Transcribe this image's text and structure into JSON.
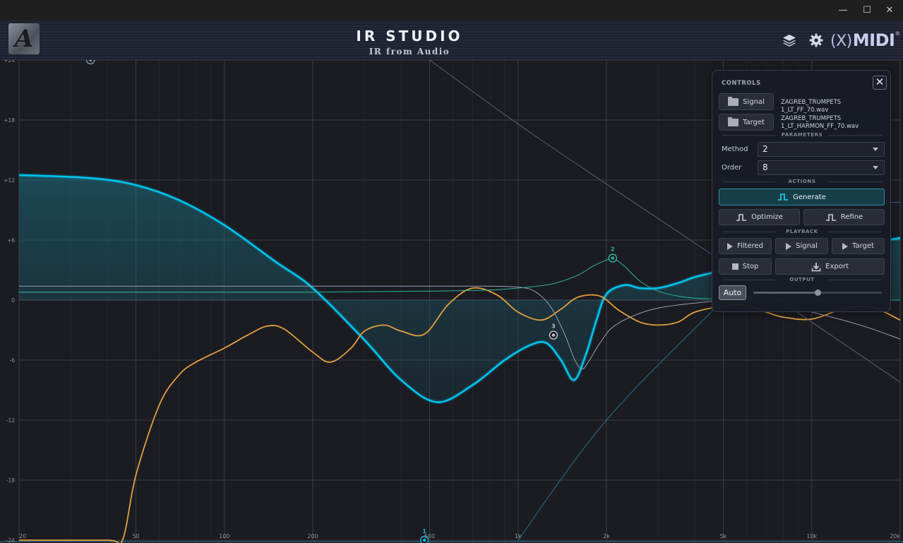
{
  "window": {
    "minimize": "—",
    "maximize": "☐",
    "close": "✕"
  },
  "header": {
    "logo_text": "A",
    "title": "IR STUDIO",
    "subtitle": "IR from Audio",
    "icons": [
      "layers-icon",
      "gear-icon"
    ],
    "brand_symbol": "(X)",
    "brand_text": "MIDI",
    "brand_mark": "®"
  },
  "controls": {
    "title": "CONTROLS",
    "close_label": "✕",
    "signal_button": "Signal",
    "signal_file": "ZAGREB_TRUMPETS 1_LT_FF_70.wav",
    "target_button": "Target",
    "target_file_line1": "ZAGREB_TRUMPETS",
    "target_file_line2": "1_LT_HARMON_FF_70.wav",
    "parameters_label": "PARAMETERS",
    "method_label": "Method",
    "method_value": "2",
    "order_label": "Order",
    "order_value": "8",
    "actions_label": "ACTIONS",
    "generate": "Generate",
    "optimize": "Optimize",
    "refine": "Refine",
    "playback_label": "PLAYBACK",
    "play_filtered": "Filtered",
    "play_signal": "Signal",
    "play_target": "Target",
    "stop": "Stop",
    "export": "Export",
    "output_label": "OUTPUT",
    "auto": "Auto",
    "output_level": 0.5
  },
  "chart_data": {
    "type": "line",
    "x_scale": "log",
    "xlim": [
      20,
      20000
    ],
    "ylim": [
      -24,
      24
    ],
    "x_ticks": [
      {
        "value": 20,
        "label": "20"
      },
      {
        "value": 50,
        "label": "50"
      },
      {
        "value": 100,
        "label": "100"
      },
      {
        "value": 200,
        "label": "200"
      },
      {
        "value": 500,
        "label": "500"
      },
      {
        "value": 1000,
        "label": "1k"
      },
      {
        "value": 2000,
        "label": "2k"
      },
      {
        "value": 5000,
        "label": "5k"
      },
      {
        "value": 10000,
        "label": "10k"
      },
      {
        "value": 20000,
        "label": "20k"
      }
    ],
    "y_ticks": [
      {
        "value": 24,
        "label": "+24"
      },
      {
        "value": 18,
        "label": "+18"
      },
      {
        "value": 12,
        "label": "+12"
      },
      {
        "value": 6,
        "label": "+6"
      },
      {
        "value": 0,
        "label": "0"
      },
      {
        "value": -6,
        "label": "-6"
      },
      {
        "value": -12,
        "label": "-12"
      },
      {
        "value": -18,
        "label": "-18"
      },
      {
        "value": -24,
        "label": "-24"
      }
    ],
    "grid": true,
    "series": [
      {
        "color": "#00c4ee",
        "width": 2.6,
        "fill": true,
        "x": [
          20,
          35,
          50,
          70,
          100,
          150,
          200,
          300,
          400,
          530,
          700,
          900,
          1100,
          1250,
          1400,
          1550,
          1700,
          1850,
          2000,
          2300,
          2600,
          3000,
          3500,
          4000,
          5000,
          6000,
          8000,
          10000,
          14000,
          20000
        ],
        "y": [
          12.5,
          12.2,
          11.5,
          10.0,
          7.5,
          3.8,
          1.2,
          -4.0,
          -8.0,
          -10.2,
          -8.5,
          -6.0,
          -4.5,
          -4.3,
          -6.0,
          -8.0,
          -5.5,
          -2.0,
          0.6,
          1.5,
          1.2,
          1.2,
          1.7,
          2.3,
          3.0,
          3.6,
          4.4,
          5.0,
          5.5,
          6.2
        ]
      },
      {
        "color": "#e3a03e",
        "width": 1.8,
        "fill": false,
        "x": [
          20,
          40,
          45,
          50,
          60,
          70,
          80,
          100,
          120,
          140,
          160,
          200,
          230,
          270,
          300,
          350,
          400,
          480,
          580,
          700,
          850,
          1000,
          1200,
          1400,
          1600,
          1900,
          2200,
          2600,
          3000,
          3500,
          4000,
          5000,
          6000,
          7000,
          8000,
          10000,
          13000,
          16000,
          20000
        ],
        "y": [
          -24,
          -24,
          -24,
          -17.5,
          -10.5,
          -7.5,
          -6.2,
          -4.8,
          -3.5,
          -2.6,
          -2.9,
          -5.2,
          -6.2,
          -4.8,
          -3.1,
          -2.5,
          -3.1,
          -3.4,
          -0.4,
          1.2,
          0.5,
          -1.2,
          -2.0,
          -0.9,
          0.3,
          0.4,
          -1.0,
          -2.2,
          -2.5,
          -2.2,
          -1.2,
          -0.6,
          -0.5,
          -1.2,
          -1.7,
          -1.9,
          -0.8,
          -0.7,
          -2.0
        ]
      },
      {
        "color": "#9aa0b2",
        "width": 1.0,
        "fill": false,
        "x": [
          20,
          100,
          300,
          700,
          1000,
          1150,
          1300,
          1450,
          1550,
          1650,
          1750,
          1900,
          2100,
          2500,
          3000,
          4000,
          5000,
          7000,
          10000,
          15000,
          20000
        ],
        "y": [
          1.4,
          1.4,
          1.4,
          1.4,
          1.3,
          0.8,
          -0.8,
          -3.6,
          -5.8,
          -6.9,
          -6.0,
          -4.3,
          -2.7,
          -1.5,
          -0.8,
          -0.3,
          -0.1,
          -0.3,
          -1.2,
          -2.6,
          -3.9
        ]
      },
      {
        "color": "#2fb39a",
        "width": 1.0,
        "fill": false,
        "x": [
          20,
          200,
          500,
          800,
          1000,
          1300,
          1600,
          1800,
          2000,
          2100,
          2300,
          2600,
          3000,
          3500,
          4000,
          5000,
          6000,
          8000,
          10000,
          20000
        ],
        "y": [
          0.8,
          0.8,
          0.9,
          1.0,
          1.2,
          1.6,
          2.5,
          3.4,
          4.0,
          4.2,
          3.4,
          1.9,
          0.9,
          0.4,
          0.2,
          0.1,
          0.05,
          0.0,
          0.0,
          0.0
        ]
      },
      {
        "color": "#5a5f6e",
        "width": 1.0,
        "fill": false,
        "x": [
          500,
          1000,
          2000,
          5000,
          10000,
          20000
        ],
        "y": [
          24,
          17.6,
          11.6,
          3.8,
          -2.2,
          -8.2
        ]
      },
      {
        "color": "#27708a",
        "width": 1.0,
        "fill": false,
        "x": [
          1000,
          2000,
          5000,
          10000,
          20000
        ],
        "y": [
          -24,
          -12,
          0.0,
          8.8,
          9.8
        ]
      }
    ],
    "nodes": [
      {
        "label": "1",
        "x": 480,
        "y": -24,
        "color": "#19b9dc"
      },
      {
        "label": "2",
        "x": 2100,
        "y": 4.2,
        "color": "#2fb39a"
      },
      {
        "label": "3",
        "x": 1320,
        "y": -3.5,
        "color": "#bfc3cc"
      },
      {
        "label": "",
        "x": 35,
        "y": 24,
        "color": "#8f95a8"
      }
    ]
  }
}
